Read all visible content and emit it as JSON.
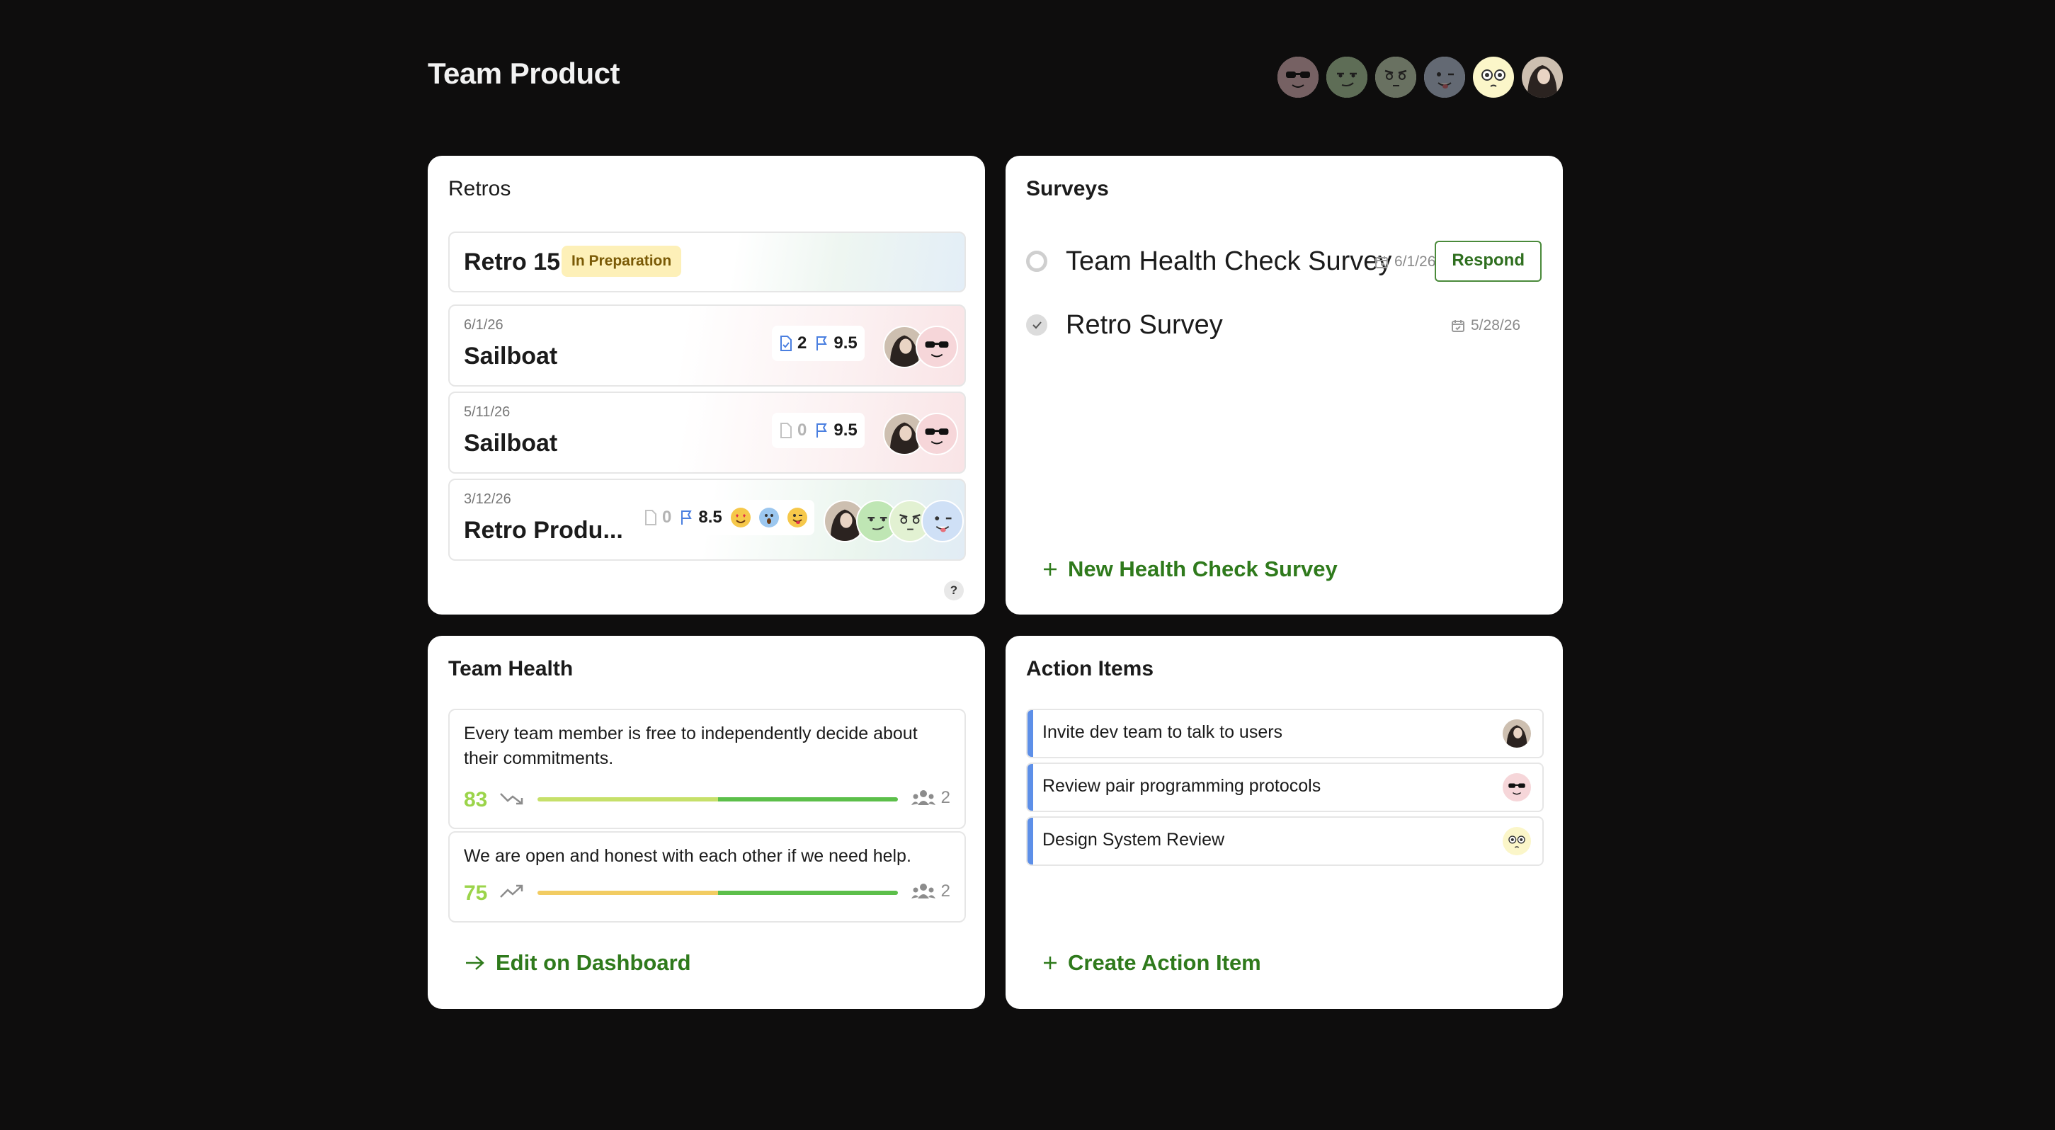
{
  "header": {
    "title": "Team Product",
    "members": [
      {
        "icon": "sunglasses-face-avatar",
        "active": false
      },
      {
        "icon": "smirk-face-avatar",
        "active": false
      },
      {
        "icon": "skeptical-face-avatar",
        "active": false
      },
      {
        "icon": "tongue-face-avatar",
        "active": false
      },
      {
        "icon": "pleading-face-avatar",
        "active": true
      },
      {
        "icon": "photo-avatar",
        "active": true
      }
    ]
  },
  "retros": {
    "title": "Retros",
    "current": {
      "name": "Retro 15",
      "status": "In Preparation"
    },
    "items": [
      {
        "date": "6/1/26",
        "name": "Sailboat",
        "notes": "2",
        "score": "9.5"
      },
      {
        "date": "5/11/26",
        "name": "Sailboat",
        "notes": "0",
        "score": "9.5"
      },
      {
        "date": "3/12/26",
        "name": "Retro Produ...",
        "notes": "0",
        "score": "8.5"
      }
    ],
    "help": "?"
  },
  "surveys": {
    "title": "Surveys",
    "items": [
      {
        "name": "Team Health Check Survey",
        "date": "6/1/26",
        "action": "Respond",
        "completed": false
      },
      {
        "name": "Retro Survey",
        "date": "5/28/26",
        "completed": true
      }
    ],
    "new_label": "New Health Check Survey"
  },
  "team_health": {
    "title": "Team Health",
    "items": [
      {
        "question": "Every team member is free to independently decide about their commitments.",
        "score": "83",
        "trend": "down",
        "responses": "2",
        "level": 0.83
      },
      {
        "question": "We are open and honest with each other if we need help.",
        "score": "75",
        "trend": "up",
        "responses": "2",
        "level": 0.75
      }
    ],
    "edit_label": "Edit on Dashboard"
  },
  "action_items": {
    "title": "Action Items",
    "items": [
      {
        "text": "Invite dev team to talk to users",
        "assignee_icon": "photo-avatar"
      },
      {
        "text": "Review pair programming protocols",
        "assignee_icon": "sunglasses-face-avatar"
      },
      {
        "text": "Design System Review",
        "assignee_icon": "pleading-face-avatar"
      }
    ],
    "create_label": "Create Action Item"
  },
  "colors": {
    "accent_green": "#2f7a1c",
    "stripe_blue": "#5d8fe8",
    "score_green": "#9bd44a",
    "badge_yellow": "#fdf0b8"
  }
}
